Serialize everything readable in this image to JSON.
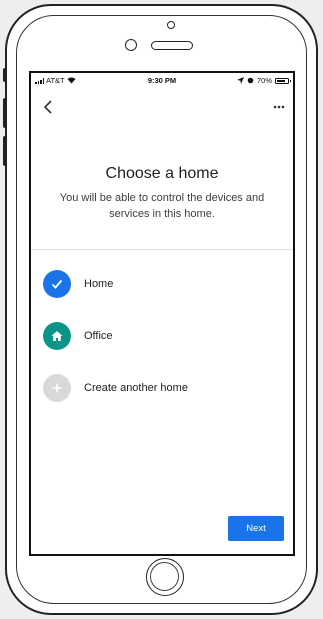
{
  "status_bar": {
    "carrier": "AT&T",
    "time": "9:30 PM",
    "battery": "70%"
  },
  "header": {
    "back_icon": "chevron-left-icon",
    "more_icon": "more-horiz-icon"
  },
  "main": {
    "title": "Choose a home",
    "subtitle": "You will be able to control the devices and services in this home."
  },
  "homes": [
    {
      "label": "Home",
      "icon": "check-icon",
      "color": "#1a73e8",
      "selected": true
    },
    {
      "label": "Office",
      "icon": "house-icon",
      "color": "#0d9488",
      "selected": false
    },
    {
      "label": "Create another home",
      "icon": "plus-icon",
      "color": "#d9d9d9",
      "selected": false
    }
  ],
  "footer": {
    "next_label": "Next"
  },
  "colors": {
    "accent": "#1a73e8",
    "teal": "#0d9488"
  }
}
